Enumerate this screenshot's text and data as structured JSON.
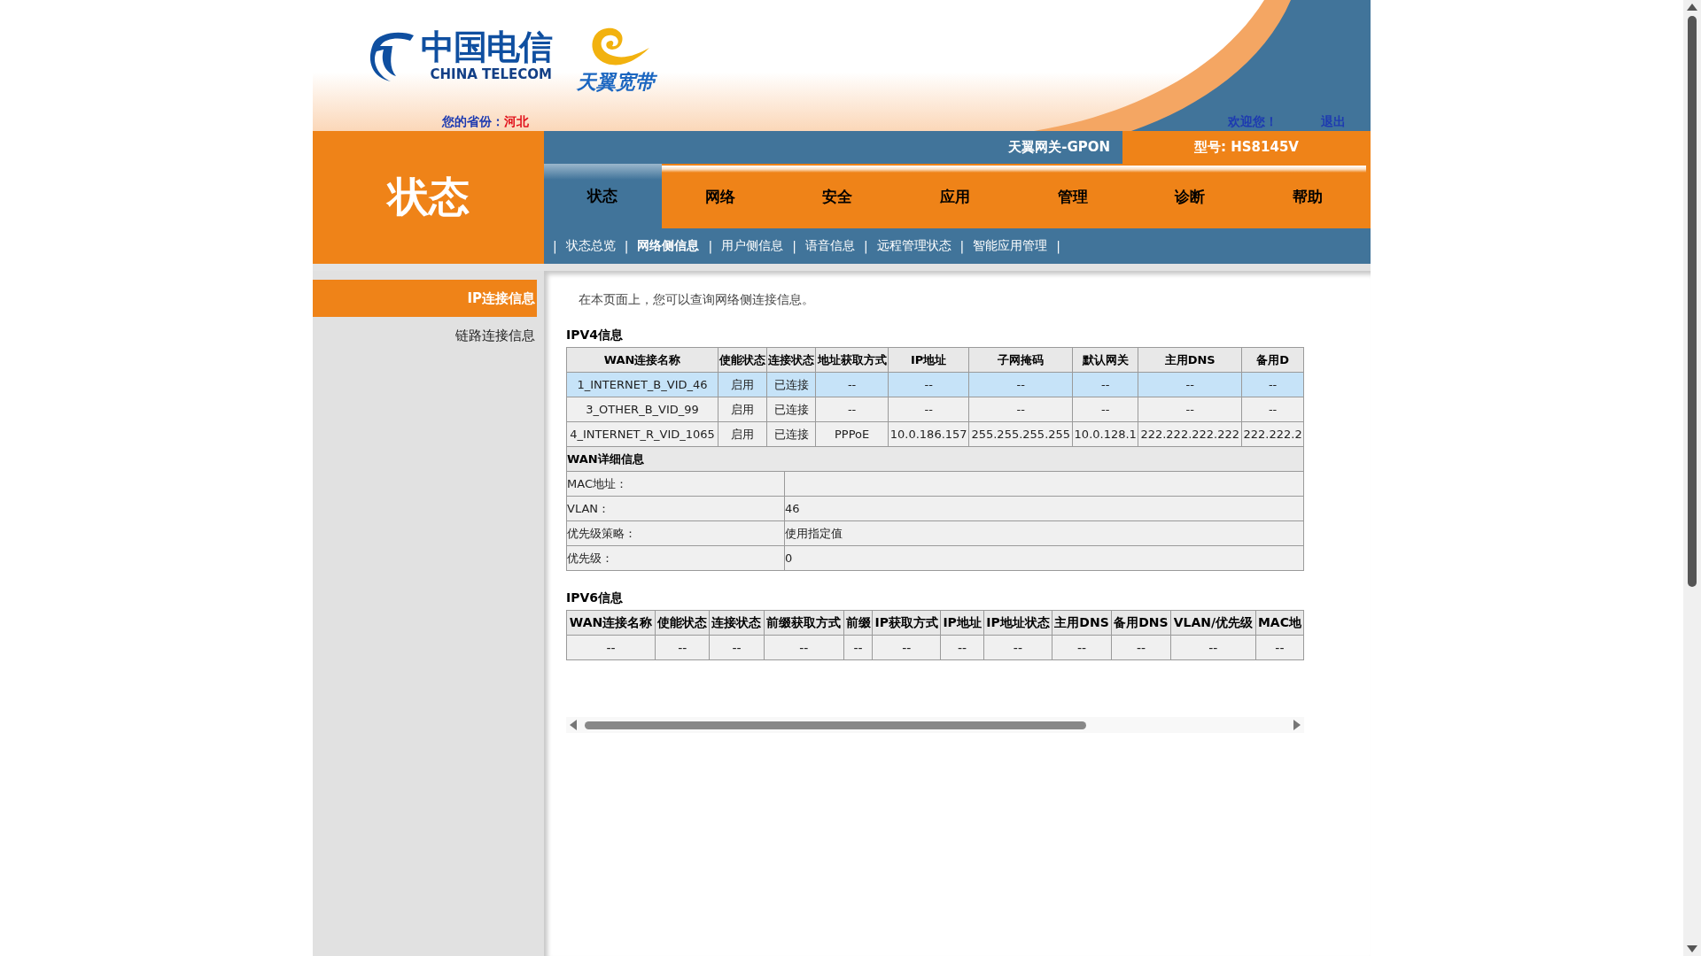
{
  "header": {
    "brand_cn": "中国电信",
    "brand_en": "CHINA TELECOM",
    "product": "天翼宽带",
    "province_label": "您的省份：",
    "province": "河北",
    "welcome": "欢迎您！",
    "logout": "退出"
  },
  "section_title": "状态",
  "gateway_name": "天翼网关-GPON",
  "model": "型号: HS8145V",
  "tabs": [
    {
      "label": "状态",
      "selected": true
    },
    {
      "label": "网络",
      "selected": false
    },
    {
      "label": "安全",
      "selected": false
    },
    {
      "label": "应用",
      "selected": false
    },
    {
      "label": "管理",
      "selected": false
    },
    {
      "label": "诊断",
      "selected": false
    },
    {
      "label": "帮助",
      "selected": false
    }
  ],
  "subnav_separator": "|",
  "subnav": [
    {
      "label": "状态总览",
      "selected": false
    },
    {
      "label": "网络侧信息",
      "selected": true
    },
    {
      "label": "用户侧信息",
      "selected": false
    },
    {
      "label": "语音信息",
      "selected": false
    },
    {
      "label": "远程管理状态",
      "selected": false
    },
    {
      "label": "智能应用管理",
      "selected": false
    }
  ],
  "sidebar": [
    {
      "label": "IP连接信息",
      "selected": true
    },
    {
      "label": "链路连接信息",
      "selected": false
    }
  ],
  "intro": "在本页面上，您可以查询网络侧连接信息。",
  "ipv4": {
    "title": "IPV4信息",
    "columns": [
      "WAN连接名称",
      "使能状态",
      "连接状态",
      "地址获取方式",
      "IP地址",
      "子网掩码",
      "默认网关",
      "主用DNS",
      "备用D"
    ],
    "rows": [
      {
        "selected": true,
        "cells": [
          "1_INTERNET_B_VID_46",
          "启用",
          "已连接",
          "--",
          "--",
          "--",
          "--",
          "--",
          "--"
        ]
      },
      {
        "selected": false,
        "cells": [
          "3_OTHER_B_VID_99",
          "启用",
          "已连接",
          "--",
          "--",
          "--",
          "--",
          "--",
          "--"
        ]
      },
      {
        "selected": false,
        "cells": [
          "4_INTERNET_R_VID_1065",
          "启用",
          "已连接",
          "PPPoE",
          "10.0.186.157",
          "255.255.255.255",
          "10.0.128.1",
          "222.222.222.222",
          "222.222.2"
        ]
      }
    ],
    "detail": {
      "title": "WAN详细信息",
      "rows": [
        {
          "label": "MAC地址："
        },
        {
          "label": "VLAN：",
          "value": "46"
        },
        {
          "label": "优先级策略：",
          "value": "使用指定值"
        },
        {
          "label": "优先级：",
          "value": "0"
        }
      ]
    }
  },
  "ipv6": {
    "title": "IPV6信息",
    "columns": [
      "WAN连接名称",
      "使能状态",
      "连接状态",
      "前缀获取方式",
      "前缀",
      "IP获取方式",
      "IP地址",
      "IP地址状态",
      "主用DNS",
      "备用DNS",
      "VLAN/优先级",
      "MAC地"
    ],
    "rows": [
      {
        "cells": [
          "--",
          "--",
          "--",
          "--",
          "--",
          "--",
          "--",
          "--",
          "--",
          "--",
          "--",
          "--"
        ]
      }
    ]
  }
}
